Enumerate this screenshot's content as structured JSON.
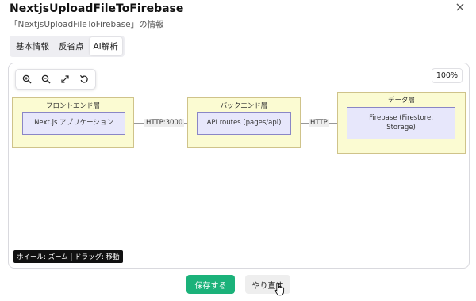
{
  "header": {
    "title": "NextjsUploadFileToFirebase",
    "subtitle": "「NextjsUploadFileToFirebase」の情報",
    "close_icon": "×"
  },
  "tabs": [
    {
      "label": "基本情報",
      "active": false
    },
    {
      "label": "反省点",
      "active": false
    },
    {
      "label": "AI解析",
      "active": true
    }
  ],
  "canvas": {
    "zoom_level": "100%",
    "hint": "ホイール: ズーム | ドラッグ: 移動",
    "toolbar": [
      "zoom-in-icon",
      "zoom-out-icon",
      "fit-screen-icon",
      "reset-icon"
    ]
  },
  "diagram": {
    "layers": [
      {
        "label": "フロントエンド層",
        "node": "Next.js アプリケーション"
      },
      {
        "label": "バックエンド層",
        "node": "API routes (pages/api)"
      },
      {
        "label": "データ層",
        "node_line1": "Firebase (Firestore,",
        "node_line2": "Storage)"
      }
    ],
    "edges": [
      {
        "label": "HTTP:3000"
      },
      {
        "label": "HTTP"
      }
    ]
  },
  "actions": {
    "save_label": "保存する",
    "redo_label": "やり直す"
  },
  "colors": {
    "accent": "#1bb27a",
    "layer_fill": "#fbfbd2",
    "node_fill": "#e7e7fb"
  }
}
